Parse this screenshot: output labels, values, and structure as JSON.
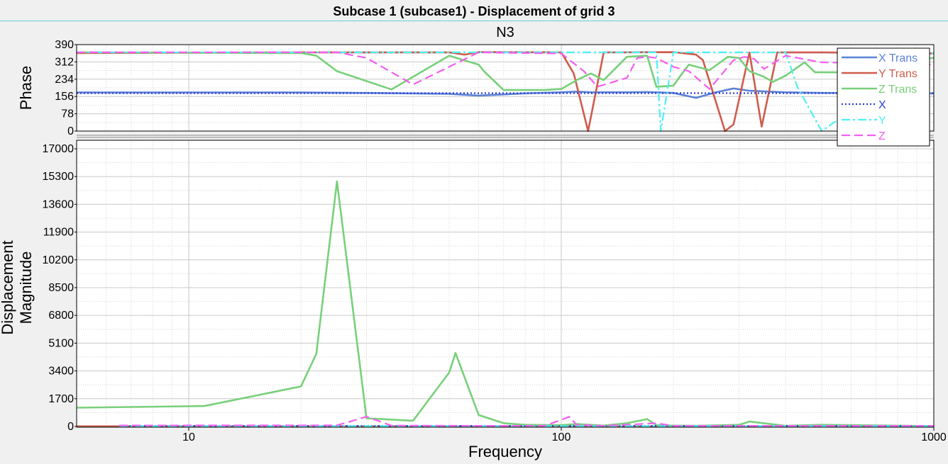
{
  "window": {
    "title": "Subcase 1 (subcase1) - Displacement of grid 3"
  },
  "colors": {
    "x_trans": "#5b82d6",
    "y_trans": "#cd5c4d",
    "z_trans": "#78d07a",
    "x": "#2c3cd8",
    "y": "#4cf0f4",
    "z": "#f45ef0",
    "grid": "#d4d4d4",
    "plot_bg": "#ffffff"
  },
  "chart_data": {
    "type": "line",
    "title": "N3",
    "x_scale": "log",
    "xlim": [
      5,
      1000
    ],
    "xlabel": "Frequency",
    "x_ticks": [
      10,
      100,
      1000
    ],
    "x_tick_labels": [
      "10",
      "100",
      "1000"
    ],
    "panels": [
      {
        "id": "phase",
        "ylabel": "Phase",
        "ylim": [
          0,
          390
        ],
        "y_ticks": [
          0,
          78,
          156,
          234,
          312,
          390
        ],
        "series": [
          {
            "name": "X Trans",
            "color_key": "x_trans",
            "dash": "solid",
            "x": [
              5,
              10,
              20,
              30,
              50,
              60,
              80,
              100,
              110,
              120,
              150,
              170,
              200,
              230,
              260,
              290,
              320,
              400,
              500,
              1000
            ],
            "y": [
              174,
              174,
              174,
              172,
              168,
              160,
              170,
              175,
              178,
              175,
              175,
              176,
              172,
              150,
              175,
              192,
              182,
              175,
              172,
              170
            ]
          },
          {
            "name": "Y Trans",
            "color_key": "y_trans",
            "dash": "solid",
            "x": [
              5,
              20,
              50,
              55,
              60,
              100,
              108,
              118,
              130,
              200,
              230,
              240,
              275,
              290,
              320,
              345,
              380,
              500,
              1000
            ],
            "y": [
              352,
              355,
              355,
              345,
              356,
              355,
              260,
              0,
              355,
              356,
              345,
              320,
              0,
              30,
              355,
              20,
              355,
              355,
              350
            ]
          },
          {
            "name": "Z Trans",
            "color_key": "z_trans",
            "dash": "solid",
            "x": [
              5,
              20,
              22,
              25,
              35,
              50,
              60,
              62,
              70,
              90,
              100,
              110,
              120,
              130,
              150,
              170,
              180,
              200,
              210,
              220,
              250,
              280,
              300,
              320,
              350,
              370,
              400,
              450,
              480,
              550,
              600,
              1000
            ],
            "y": [
              355,
              352,
              340,
              270,
              188,
              340,
              300,
              270,
              185,
              185,
              190,
              230,
              260,
              230,
              335,
              340,
              200,
              205,
              255,
              300,
              275,
              335,
              330,
              270,
              245,
              222,
              250,
              310,
              265,
              265,
              300,
              330
            ]
          },
          {
            "name": "X",
            "color_key": "x",
            "dash": "dot",
            "x": [
              5,
              1000
            ],
            "y": [
              171,
              171
            ]
          },
          {
            "name": "Y",
            "color_key": "y",
            "dash": "dashdot",
            "x": [
              5,
              100,
              180,
              185,
              200,
              215,
              300,
              330,
              400,
              430,
              500,
              1000
            ],
            "y": [
              355,
              355,
              355,
              0,
              355,
              355,
              355,
              355,
              355,
              200,
              0,
              355
            ]
          },
          {
            "name": "Z",
            "color_key": "z",
            "dash": "dash",
            "x": [
              5,
              25,
              30,
              40,
              60,
              80,
              100,
              115,
              125,
              150,
              160,
              170,
              180,
              200,
              220,
              250,
              290,
              310,
              330,
              350,
              400,
              500,
              1000
            ],
            "y": [
              355,
              355,
              330,
              210,
              355,
              352,
              350,
              270,
              200,
              240,
              330,
              335,
              330,
              290,
              270,
              190,
              320,
              335,
              325,
              280,
              340,
              310,
              300
            ]
          }
        ]
      },
      {
        "id": "magnitude",
        "ylabel_lines": [
          "Displacement",
          "Magnitude"
        ],
        "ylim": [
          0,
          17000
        ],
        "y_ticks": [
          0,
          1700,
          3400,
          5100,
          6800,
          8500,
          10200,
          11900,
          13600,
          15300,
          17000
        ],
        "series": [
          {
            "name": "X Trans",
            "color_key": "x_trans",
            "dash": "solid",
            "x": [
              5,
              1000
            ],
            "y": [
              10,
              10
            ]
          },
          {
            "name": "Y Trans",
            "color_key": "y_trans",
            "dash": "solid",
            "x": [
              5,
              1000
            ],
            "y": [
              5,
              5
            ]
          },
          {
            "name": "Z Trans",
            "color_key": "z_trans",
            "dash": "solid",
            "x": [
              5,
              11,
              20,
              22,
              25,
              30,
              40,
              50,
              52,
              60,
              70,
              80,
              100,
              110,
              130,
              150,
              170,
              180,
              200,
              230,
              300,
              320,
              400,
              500,
              1000
            ],
            "y": [
              1150,
              1250,
              2450,
              4450,
              15000,
              500,
              350,
              3300,
              4500,
              700,
              200,
              100,
              80,
              150,
              50,
              200,
              450,
              80,
              50,
              40,
              100,
              300,
              40,
              100,
              20
            ]
          },
          {
            "name": "X",
            "color_key": "x",
            "dash": "dot",
            "x": [
              6.5,
              1000
            ],
            "y": [
              40,
              40
            ]
          },
          {
            "name": "Y",
            "color_key": "y",
            "dash": "dashdot",
            "x": [
              6.5,
              1000
            ],
            "y": [
              20,
              20
            ]
          },
          {
            "name": "Z",
            "color_key": "z",
            "dash": "dash",
            "x": [
              6.5,
              25,
              30,
              35,
              60,
              90,
              100,
              105,
              110,
              130,
              180,
              200,
              300,
              500,
              1000
            ],
            "y": [
              60,
              70,
              600,
              50,
              40,
              40,
              400,
              600,
              100,
              40,
              200,
              40,
              40,
              40,
              40
            ]
          }
        ]
      }
    ],
    "legend": {
      "placement": "top-right",
      "entries": [
        "X Trans",
        "Y Trans",
        "Z Trans",
        "X",
        "Y",
        "Z"
      ]
    }
  }
}
